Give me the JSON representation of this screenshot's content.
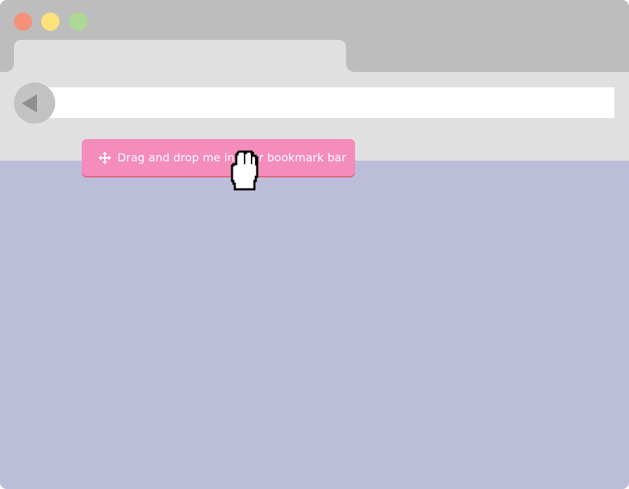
{
  "window": {
    "traffic_lights": [
      "close",
      "minimize",
      "maximize"
    ],
    "colors": {
      "close": "#f5907a",
      "minimize": "#fde279",
      "maximize": "#aed994",
      "titlebar": "#bdbdbd",
      "toolbar": "#e0e0e0",
      "content": "#bcbdd9"
    }
  },
  "tab": {
    "title": ""
  },
  "toolbar": {
    "back_icon": "back-arrow-icon",
    "address_value": ""
  },
  "bookmarklet": {
    "icon": "move-arrows-icon",
    "label": "Drag and drop me in your bookmark bar",
    "color": "#f48cbc"
  },
  "cursor": {
    "icon": "hand-grab-cursor-icon"
  }
}
